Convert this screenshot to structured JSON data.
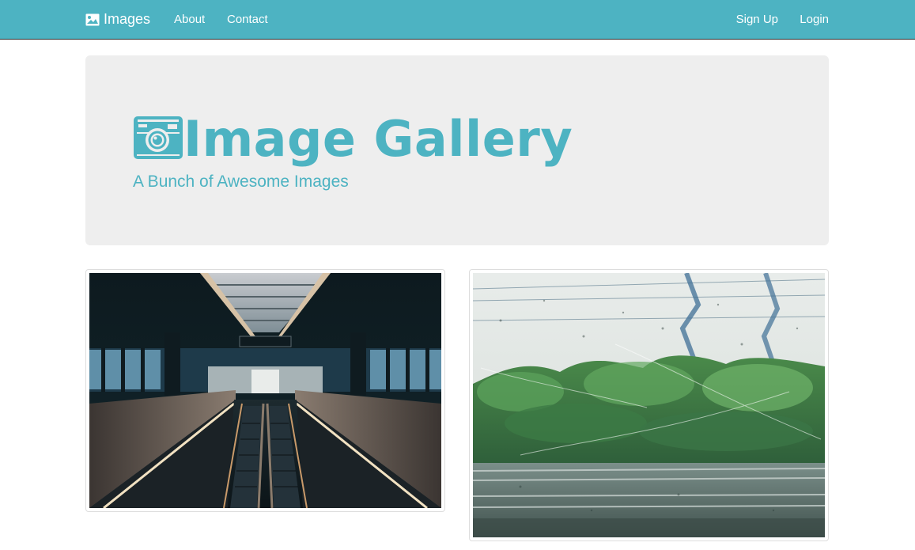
{
  "navbar": {
    "brand_icon": "picture-icon",
    "brand_label": "Images",
    "links": {
      "about": "About",
      "contact": "Contact",
      "signup": "Sign Up",
      "login": "Login"
    },
    "background": "#4db3c2"
  },
  "jumbotron": {
    "icon": "camera-icon",
    "title": "Image Gallery",
    "subtitle": "A Bunch of Awesome Images",
    "accent": "#4db3c2",
    "background": "#eeeeee"
  },
  "gallery": {
    "images": [
      {
        "subject": "station-escalator-photo"
      },
      {
        "subject": "rainy-train-window-photo"
      }
    ]
  }
}
